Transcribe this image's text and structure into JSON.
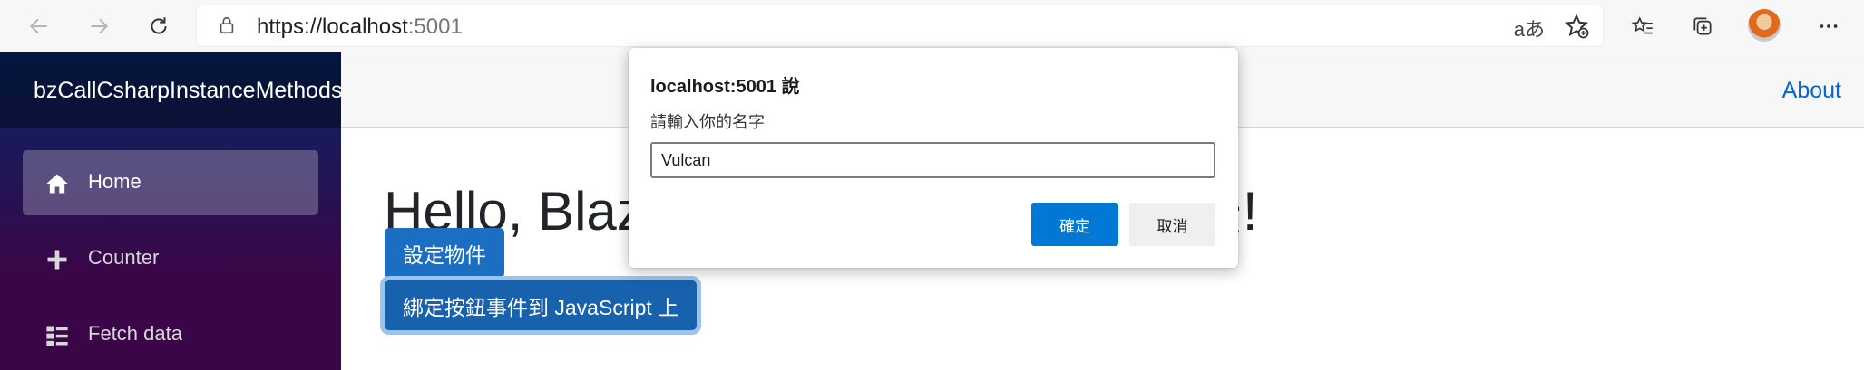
{
  "browser": {
    "url_scheme_host": "https://localhost",
    "url_port": ":5001",
    "read_aloud_label": "aあ",
    "icons": [
      "back-icon",
      "forward-icon",
      "refresh-icon",
      "lock-icon",
      "favorite-add-icon",
      "favorites-icon",
      "collections-icon",
      "profile-avatar",
      "more-icon"
    ]
  },
  "sidebar": {
    "brand": "bzCallCsharpInstanceMethods",
    "items": [
      {
        "label": "Home",
        "icon": "home-icon",
        "active": true
      },
      {
        "label": "Counter",
        "icon": "plus-icon",
        "active": false
      },
      {
        "label": "Fetch data",
        "icon": "list-icon",
        "active": false
      }
    ]
  },
  "topbar": {
    "about_label": "About"
  },
  "main": {
    "heading": "Hello, Blazor 呼叫 C# 執行個體方法!",
    "buttons": [
      "設定物件",
      "綁定按鈕事件到 JavaScript 上"
    ]
  },
  "dialog": {
    "title": "localhost:5001 說",
    "message": "請輸入你的名字",
    "input_value": "Vulcan",
    "ok_label": "確定",
    "cancel_label": "取消"
  },
  "colors": {
    "accent": "#0078d4",
    "link": "#0366d6",
    "primary_button": "#1b6ec2"
  }
}
